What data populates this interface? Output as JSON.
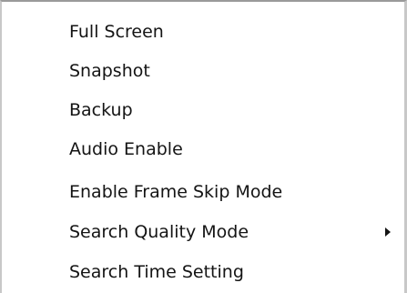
{
  "menu": {
    "items": [
      {
        "label": "Full Screen"
      },
      {
        "label": "Snapshot"
      },
      {
        "label": "Backup"
      },
      {
        "label": "Audio Enable"
      },
      {
        "label": "Enable Frame Skip Mode"
      },
      {
        "label": "Search Quality Mode",
        "submenu_icon": "chevron-right-icon"
      },
      {
        "label": "Search Time Setting"
      }
    ]
  },
  "colors": {
    "text": "#141414",
    "background": "#ffffff",
    "border": "#9a9a9a"
  }
}
